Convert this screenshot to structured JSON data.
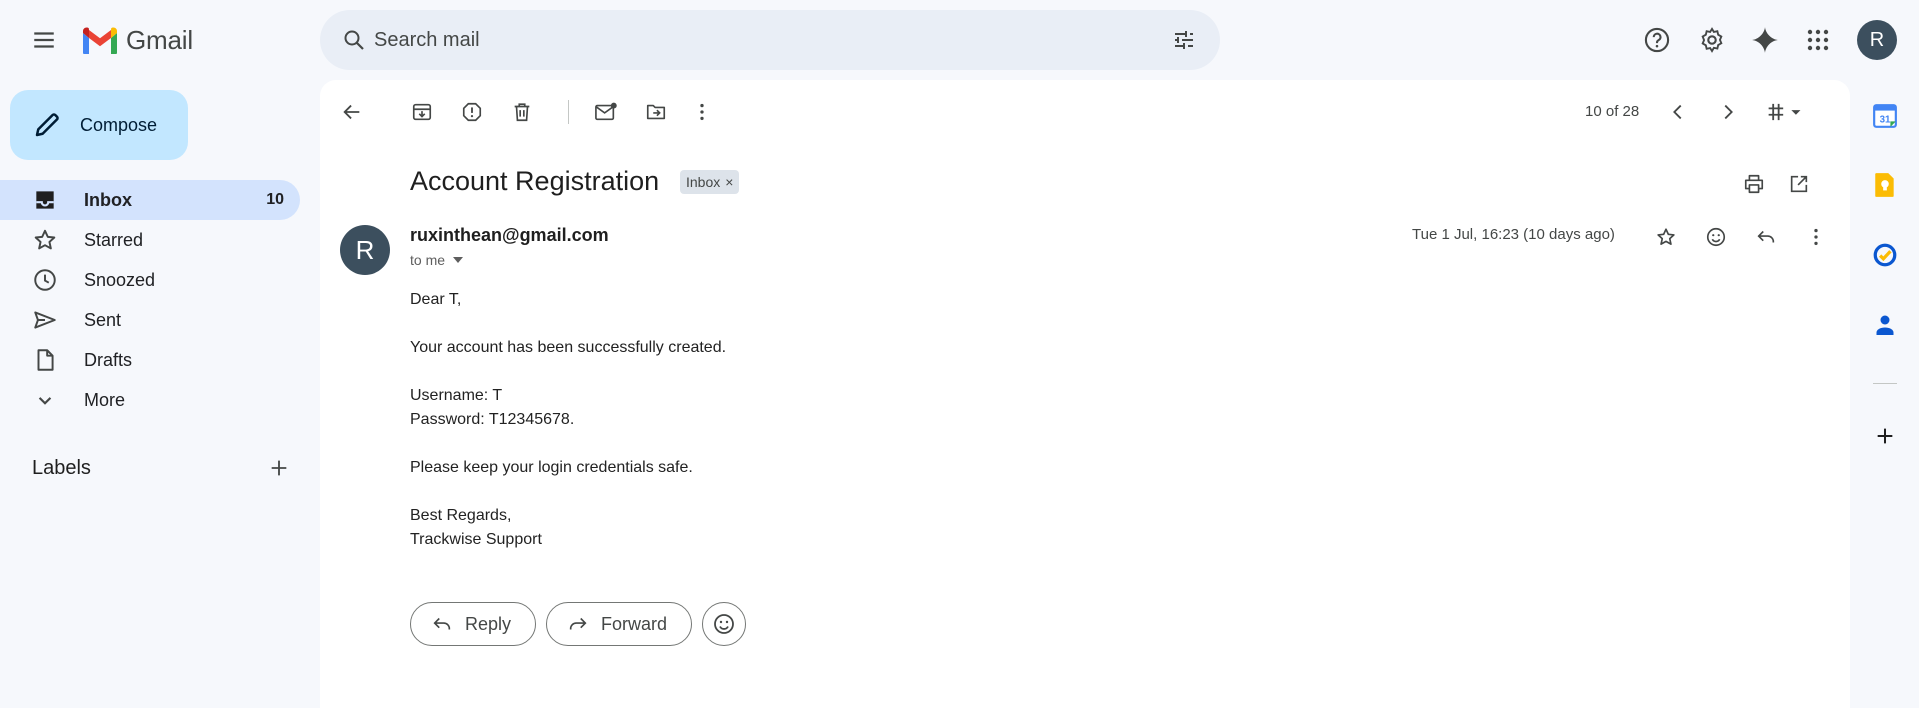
{
  "app": {
    "name": "Gmail"
  },
  "search": {
    "placeholder": "Search mail"
  },
  "compose": {
    "label": "Compose"
  },
  "nav": {
    "items": [
      {
        "label": "Inbox",
        "count": "10",
        "icon": "inbox-icon",
        "active": true
      },
      {
        "label": "Starred",
        "count": "",
        "icon": "star-icon"
      },
      {
        "label": "Snoozed",
        "count": "",
        "icon": "clock-icon"
      },
      {
        "label": "Sent",
        "count": "",
        "icon": "send-icon"
      },
      {
        "label": "Drafts",
        "count": "",
        "icon": "draft-icon"
      },
      {
        "label": "More",
        "count": "",
        "icon": "chevron-down-icon"
      }
    ],
    "labels_heading": "Labels"
  },
  "user": {
    "initial": "R"
  },
  "toolbar": {
    "pager": "10 of 28"
  },
  "email": {
    "subject": "Account Registration",
    "label_badge": "Inbox",
    "badge_close": "×",
    "sender_initial": "R",
    "sender": "ruxinthean@gmail.com",
    "to": "to me",
    "date": "Tue 1 Jul, 16:23 (10 days ago)",
    "body": [
      "Dear T,",
      "",
      "Your account has been successfully created.",
      "",
      "Username: T",
      "Password: T12345678.",
      "",
      "Please keep your login credentials safe.",
      "",
      "Best Regards,",
      "Trackwise Support"
    ]
  },
  "actions": {
    "reply": "Reply",
    "forward": "Forward"
  },
  "colors": {
    "accent": "#0b57d0",
    "compose_bg": "#c2e7ff",
    "active_nav": "#d3e3fd",
    "avatar": "#3c4f5e"
  }
}
